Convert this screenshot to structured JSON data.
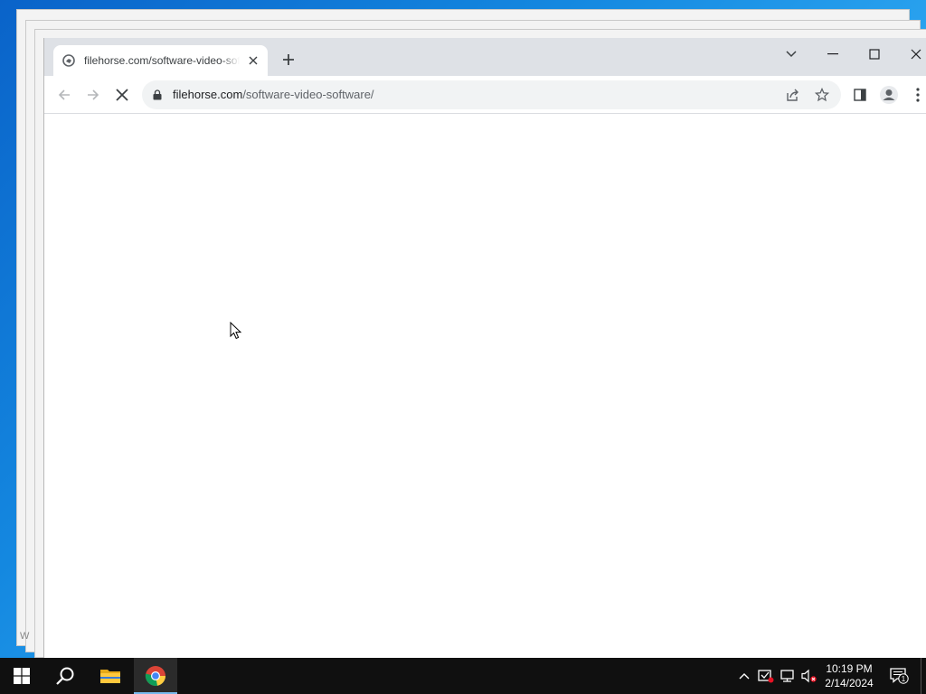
{
  "browser": {
    "tab": {
      "title": "filehorse.com/software-video-software/"
    },
    "address_bar": {
      "host": "filehorse.com",
      "path": "/software-video-software/"
    }
  },
  "taskbar": {
    "clock_time": "10:19 PM",
    "clock_date": "2/14/2024",
    "notification_count": "1"
  },
  "colors": {
    "titlebar": "#dee1e6",
    "omnibox": "#f1f3f4",
    "taskbar": "#101010",
    "desktop_accent": "#1488e0"
  },
  "icons": {
    "tab_favicon": "filehorse-favicon",
    "reload_state": "stop-loading-icon"
  }
}
